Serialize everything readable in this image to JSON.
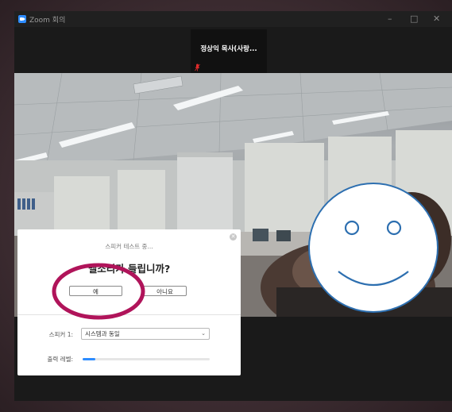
{
  "window": {
    "title": "Zoom 회의",
    "minimize_glyph": "–",
    "maximize_glyph": "□",
    "close_glyph": "✕"
  },
  "participant": {
    "name": "정상익 목사(사랑..."
  },
  "dialog": {
    "subtitle": "스피커 테스트 중...",
    "question": "벨소리가 들립니까?",
    "yes_label": "예",
    "no_label": "아니요",
    "close_glyph": "✕",
    "speaker_label": "스피커 1:",
    "speaker_value": "시스템과 동일",
    "level_label": "출력 레벨:",
    "output_level": 0.1
  },
  "colors": {
    "accent": "#2d8cff",
    "annotation_ring": "#b0145a",
    "smiley": "#2d6fb0",
    "mic_muted": "#e02b2b"
  },
  "icons": {
    "app": "zoom-camera-icon",
    "mic": "mic-muted-icon",
    "dropdown": "chevron-down-icon"
  }
}
